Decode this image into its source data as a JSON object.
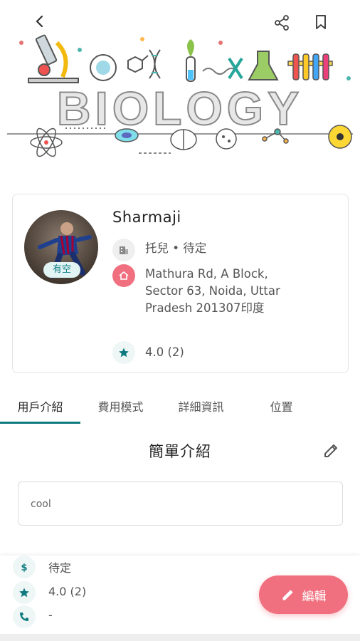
{
  "header": {
    "banner_text": "BIOLOGY",
    "back_icon": "chevron-left-icon",
    "share_icon": "share-icon",
    "bookmark_icon": "bookmark-icon"
  },
  "profile": {
    "name": "Sharmaji",
    "availability_badge": "有空",
    "category": "托兒 • 待定",
    "address": [
      "Mathura Rd, A Block,",
      "Sector 63, Noida, Uttar",
      "Pradesh 201307印度"
    ],
    "rating": "4.0 (2)"
  },
  "tabs": [
    {
      "label": "用戶介紹",
      "active": true
    },
    {
      "label": "費用模式",
      "active": false
    },
    {
      "label": "詳細資訊",
      "active": false
    },
    {
      "label": "位置",
      "active": false
    }
  ],
  "intro": {
    "title": "簡單介紹",
    "text": "cool"
  },
  "details": {
    "price": "待定",
    "rating": "4.0 (2)",
    "phone": "-"
  },
  "fab": {
    "label": "編輯"
  },
  "colors": {
    "accent": "#0f7a80",
    "fab": "#f0707f",
    "home_icon_bg": "#f0707f",
    "badge_bg": "#e1f3f2"
  }
}
